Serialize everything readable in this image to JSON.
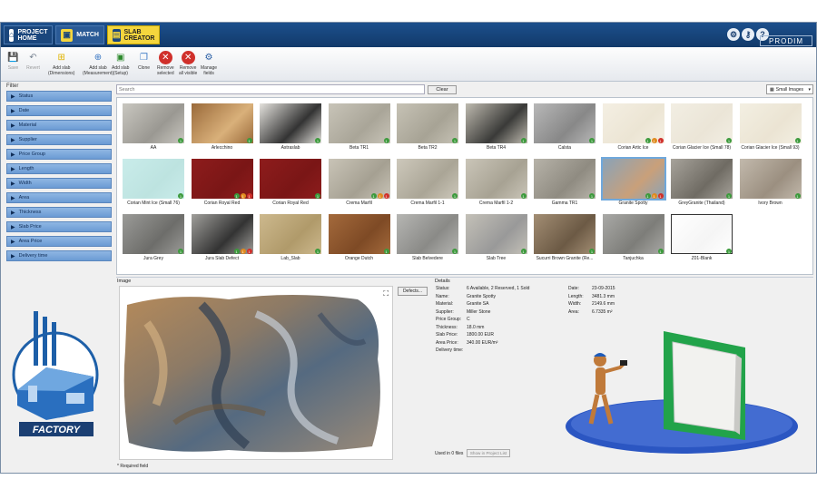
{
  "tabs": [
    {
      "label_l1": "PROJECT",
      "label_l2": "HOME",
      "icon": "home-icon"
    },
    {
      "label_l1": "MATCH",
      "label_l2": "",
      "icon": "match-icon"
    },
    {
      "label_l1": "SLAB",
      "label_l2": "CREATOR",
      "icon": "slab-creator-icon"
    }
  ],
  "header_icons": [
    "gear-icon",
    "key-icon",
    "help-icon"
  ],
  "brand": "PRODIM",
  "toolbar": [
    {
      "l1": "Save",
      "l2": "",
      "icon": "save-icon",
      "disabled": true
    },
    {
      "l1": "Revert",
      "l2": "",
      "icon": "revert-icon",
      "disabled": true
    },
    {
      "l1": "Add slab",
      "l2": "(Dimensions)",
      "icon": "add-slab-dimensions-icon",
      "disabled": false
    },
    {
      "l1": "Add slab",
      "l2": "(Measurement)",
      "icon": "add-slab-measurement-icon",
      "disabled": false
    },
    {
      "l1": "Add slab",
      "l2": "(Setup)",
      "icon": "add-slab-setup-icon",
      "disabled": false
    },
    {
      "l1": "Clone",
      "l2": "",
      "icon": "clone-icon",
      "disabled": false
    },
    {
      "l1": "Remove",
      "l2": "selected",
      "icon": "remove-selected-icon",
      "disabled": false
    },
    {
      "l1": "Remove",
      "l2": "all visible",
      "icon": "remove-all-icon",
      "disabled": false
    },
    {
      "l1": "Manage",
      "l2": "fields",
      "icon": "manage-fields-icon",
      "disabled": false
    }
  ],
  "filter": {
    "label": "Filter",
    "items": [
      "Status",
      "Date",
      "Material",
      "Supplier",
      "Price Group",
      "Length",
      "Width",
      "Area",
      "Thickness",
      "Slab Price",
      "Area Price",
      "Delivery time"
    ]
  },
  "logo_text": "FACTORY",
  "search": {
    "placeholder": "Search",
    "clear_label": "Clear",
    "view_option": "Small Images"
  },
  "slabs": [
    {
      "name": "AA",
      "color": "#c9c7c0",
      "tex": "#9a9892",
      "badges": [
        "1g"
      ]
    },
    {
      "name": "Arlecchino",
      "color": "#9a6a3a",
      "tex": "#d9b07a",
      "badges": [
        "1g"
      ]
    },
    {
      "name": "Astraslab",
      "color": "#e4e2dd",
      "tex": "#333",
      "badges": [
        "1g"
      ]
    },
    {
      "name": "Beta TR1",
      "color": "#c8c4b8",
      "tex": "#a9a598",
      "badges": [
        "1g"
      ]
    },
    {
      "name": "Beta TR2",
      "color": "#c6c2b5",
      "tex": "#a7a395",
      "badges": [
        "1g"
      ]
    },
    {
      "name": "Beta TR4",
      "color": "#bfbbb0",
      "tex": "#3a3a38",
      "badges": [
        "1g"
      ]
    },
    {
      "name": "Calsta",
      "color": "#b8b8b8",
      "tex": "#888",
      "badges": [
        "1g"
      ]
    },
    {
      "name": "Corian Artic Ice",
      "color": "#f4efe3",
      "tex": "#ece5d4",
      "badges": [
        "1g",
        "1o",
        "1r"
      ]
    },
    {
      "name": "Corian Glacier Ice (Small 78)",
      "color": "#f2eee3",
      "tex": "#ebe5d7",
      "badges": [
        "1g"
      ]
    },
    {
      "name": "Corian Glacier Ice (Small 93)",
      "color": "#f3efe2",
      "tex": "#ebe4d3",
      "badges": [
        "1g"
      ]
    },
    {
      "name": "Corian Mint Ice (Small 76)",
      "color": "#c9ecea",
      "tex": "#bde3e0",
      "badges": [
        "1g"
      ]
    },
    {
      "name": "Corian Royal Red",
      "color": "#8e1c1c",
      "tex": "#7a1616",
      "badges": [
        "1g",
        "1o",
        "1r"
      ]
    },
    {
      "name": "Corian Royal Red",
      "color": "#8e1c1c",
      "tex": "#7a1616",
      "badges": [
        "1g"
      ]
    },
    {
      "name": "Crema Marfil",
      "color": "#c9c4b7",
      "tex": "#a5a092",
      "badges": [
        "1g",
        "1o",
        "1r"
      ]
    },
    {
      "name": "Crema Marfil 1-1",
      "color": "#cdc8bb",
      "tex": "#aaa596",
      "badges": [
        "1g"
      ]
    },
    {
      "name": "Crema Marfil 1-2",
      "color": "#cac5b8",
      "tex": "#a7a293",
      "badges": [
        "1g"
      ]
    },
    {
      "name": "Gamma TR1",
      "color": "#b7b3a9",
      "tex": "#8f8b81",
      "badges": [
        "1g"
      ]
    },
    {
      "name": "Granite Spotty",
      "color": "#8aa3b8",
      "tex": "#c9a07a",
      "badges": [
        "1g",
        "1o",
        "1r"
      ],
      "selected": true
    },
    {
      "name": "GreyGranite (Thailand)",
      "color": "#a7a39b",
      "tex": "#6f6b63",
      "badges": [
        "1g"
      ]
    },
    {
      "name": "Ivory Brown",
      "color": "#c2b9ac",
      "tex": "#9b8f80",
      "badges": [
        "1g"
      ]
    },
    {
      "name": "Jura Grey",
      "color": "#9b9b98",
      "tex": "#6d6d6a",
      "badges": [
        "1g"
      ]
    },
    {
      "name": "Jura Slab Defect",
      "color": "#a09f9b",
      "tex": "#333",
      "badges": [
        "1g",
        "1o",
        "1r"
      ]
    },
    {
      "name": "Lab_Slab",
      "color": "#cdb98e",
      "tex": "#b09a6a",
      "badges": [
        "1g"
      ]
    },
    {
      "name": "Orange Dutch",
      "color": "#a46a3c",
      "tex": "#7e4a25",
      "badges": [
        "1g"
      ]
    },
    {
      "name": "Slab Belvedere",
      "color": "#b6b6b3",
      "tex": "#8a8a87",
      "badges": [
        "1g"
      ]
    },
    {
      "name": "Slab Tree",
      "color": "#c4c1b8",
      "tex": "#999",
      "badges": [
        "1g"
      ]
    },
    {
      "name": "Sucurri Brown Granite (Re...",
      "color": "#a38e74",
      "tex": "#6c5a45",
      "badges": [
        "1g"
      ]
    },
    {
      "name": "Tanjuchka",
      "color": "#a9a9a6",
      "tex": "#7d7d79",
      "badges": [
        "1g"
      ]
    },
    {
      "name": "Z01-Blank",
      "color": "#ffffff",
      "tex": "#f5f5f5",
      "badges": [
        "1g"
      ]
    }
  ],
  "image_label": "Image",
  "defects_label": "Defects...",
  "details_label": "Details",
  "details_left": [
    {
      "k": "Status:",
      "v": "6 Available, 2 Reserved, 1 Sold"
    },
    {
      "k": "Name:",
      "v": "Granite Spotty"
    },
    {
      "k": "Material:",
      "v": "Granite SA"
    },
    {
      "k": "Supplier:",
      "v": "Miller Stone"
    },
    {
      "k": "Price Group:",
      "v": "C"
    },
    {
      "k": "Thickness:",
      "v": "18.0 mm"
    },
    {
      "k": "Slab Price:",
      "v": "1800.00 EUR"
    },
    {
      "k": "Area Price:",
      "v": "340.00 EUR/m²"
    },
    {
      "k": "Delivery time:",
      "v": ""
    }
  ],
  "details_right": [
    {
      "k": "Date:",
      "v": "23-09-2015"
    },
    {
      "k": "Length:",
      "v": "3481.3 mm"
    },
    {
      "k": "Width:",
      "v": "2149.6 mm"
    },
    {
      "k": "Area:",
      "v": "6.7335 m²"
    }
  ],
  "used_label": "Used in 0 files",
  "show_in_project_list": "Show in Project List",
  "required_note": "* Required field",
  "colors": {
    "header": "#1c4f8c",
    "accent": "#f5d63d",
    "filter": "#7ea9dc",
    "badge_green": "#3c9a3c",
    "badge_orange": "#e08a1e",
    "badge_red": "#d0302b"
  }
}
